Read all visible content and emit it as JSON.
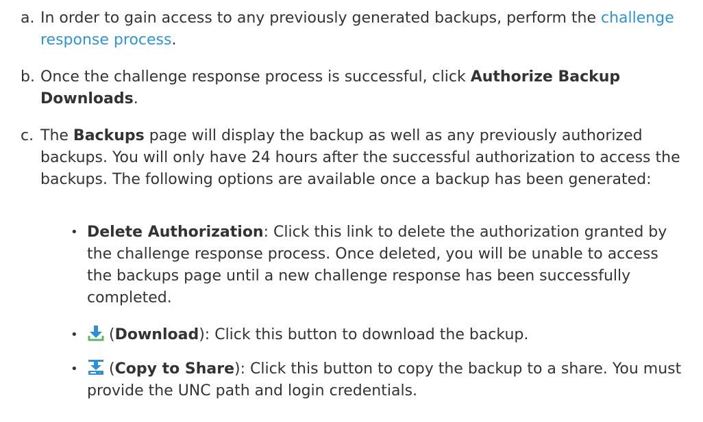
{
  "steps": [
    {
      "marker": "a.",
      "text_before": "In order to gain access to any previously generated backups, perform the",
      "link": "challenge response process",
      "text_after": "."
    },
    {
      "marker": "b.",
      "text_before": "Once the challenge response process is successful, click",
      "bold": "Authorize Backup Downloads",
      "text_after": "."
    },
    {
      "marker": "c.",
      "text_before": "The",
      "bold": "Backups",
      "text_after": "page will display the backup as well as any previously authorized backups. You will only have 24 hours after the successful authorization to access the backups. The following options are available once a backup has been generated:"
    }
  ],
  "options": [
    {
      "bullet": "•",
      "title": "Delete Authorization",
      "description": ": Click this link to delete the authorization granted by the challenge response process. Once deleted, you will be unable to access the backups page until a new challenge response has been successfully completed."
    },
    {
      "bullet": "•",
      "icon": "download-icon",
      "paren_open": "(",
      "title": "Download",
      "description": "): Click this button to download the backup."
    },
    {
      "bullet": "•",
      "icon": "copy-to-share-icon",
      "paren_open": "(",
      "title": "Copy to Share",
      "description": "): Click this button to copy the backup to a share. You must provide the UNC path and login credentials."
    }
  ],
  "colors": {
    "link": "#2e95d3",
    "text": "#333333",
    "icon_blue": "#2f8fd6",
    "icon_green": "#5cb85c"
  }
}
